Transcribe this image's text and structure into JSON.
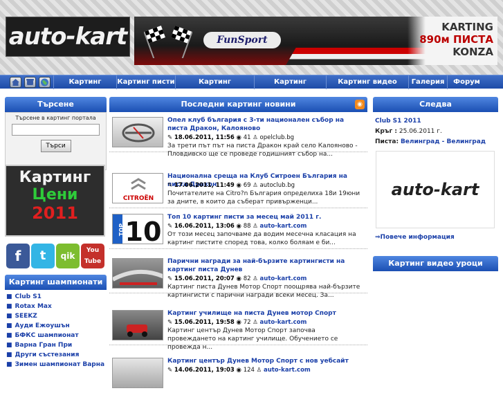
{
  "header": {
    "logo_text": "auto-kart",
    "banner_funsport": "FunSport",
    "ad_line1": "KARTING",
    "ad_line2": "890м ПИСТА",
    "ad_line3": "KONZA"
  },
  "nav": {
    "icons": [
      "home-icon",
      "phone-icon",
      "globe-icon"
    ],
    "items": [
      "Картинг новини",
      "Картинг писти",
      "Картинг шампионати",
      "Картинг календар",
      "Картинг видео уроци",
      "Галерия",
      "Форум"
    ]
  },
  "search": {
    "title": "Търсене",
    "caption": "Търсене в картинг портала",
    "input_value": "",
    "button_label": "Търси"
  },
  "prices_banner": {
    "line1": "Картинг",
    "line2": "Цени",
    "line3": "2011"
  },
  "social": [
    "f",
    "t",
    "qik",
    "You Tube"
  ],
  "championships": {
    "title": "Картинг шампионати",
    "items": [
      "Club S1",
      "Rotax Max",
      "SEEKZ",
      "Ауди Ежоушън",
      "БФКС шампионат",
      "Варна Гран При",
      "Други състезания",
      "Зимен шампионат Варна"
    ]
  },
  "news": {
    "title": "Последни картинг новини",
    "items": [
      {
        "title": "Опел клуб българия с 3-ти национален събор на писта Дракон, Калояново",
        "date": "18.06.2011, 11:56",
        "views": "41",
        "source": "opelclub.bg",
        "excerpt": "За трети път път на писта Дракон край село Калояново - Пловдивско ще се проведе годишният събор на..."
      },
      {
        "title": "Национална среща на Клуб Ситроен България на писта Дракон",
        "date": "17.06.2011, 11:49",
        "views": "69",
        "source": "autoclub.bg",
        "excerpt": "Почитателите на Citro?n България определиха 18и 19юни за дните, в които да съберат привърженци..."
      },
      {
        "title": "Топ 10 картинг писти за месец май 2011 г.",
        "date": "16.06.2011, 13:06",
        "views": "88",
        "source": "auto-kart.com",
        "excerpt": "От този месец започваме да водим месечна класация на картинг пистите според това, колко боляам е би..."
      },
      {
        "title": "Парични награди за най-бързите картингисти на картинг писта Дунев",
        "date": "15.06.2011, 20:07",
        "views": "82",
        "source": "auto-kart.com",
        "excerpt": "Картинг писта Дунев Мотор Спорт поощрява най-бързите картингисти с парични награди всеки месец. За..."
      },
      {
        "title": "Картинг училище на писта Дунев мотор Спорт",
        "date": "15.06.2011, 19:58",
        "views": "72",
        "source": "auto-kart.com",
        "excerpt": "Картинг център Дунев Мотор Спорт започва провеждането на картинг училище. Обучението се провежда н..."
      },
      {
        "title": "Картинг център Дунев Мотор Спорт с нов уебсайт",
        "date": "14.06.2011, 19:03",
        "views": "124",
        "source": "auto-kart.com",
        "excerpt": ""
      }
    ]
  },
  "next": {
    "title": "Следва",
    "event": "Club S1 2011",
    "round_label": "Кръг :",
    "round_date": "25.06.2011 г.",
    "track_label": "Писта:",
    "track": "Велинград - Велинград",
    "logo_text": "auto-kart",
    "more": "⇒Повече информация"
  },
  "video": {
    "title": "Картинг видео уроци"
  },
  "colors": {
    "nav_blue": "#1d4ba7",
    "link_blue": "#1a3fa8",
    "prices_green": "#2ecc3a",
    "prices_red": "#e01f1f"
  }
}
